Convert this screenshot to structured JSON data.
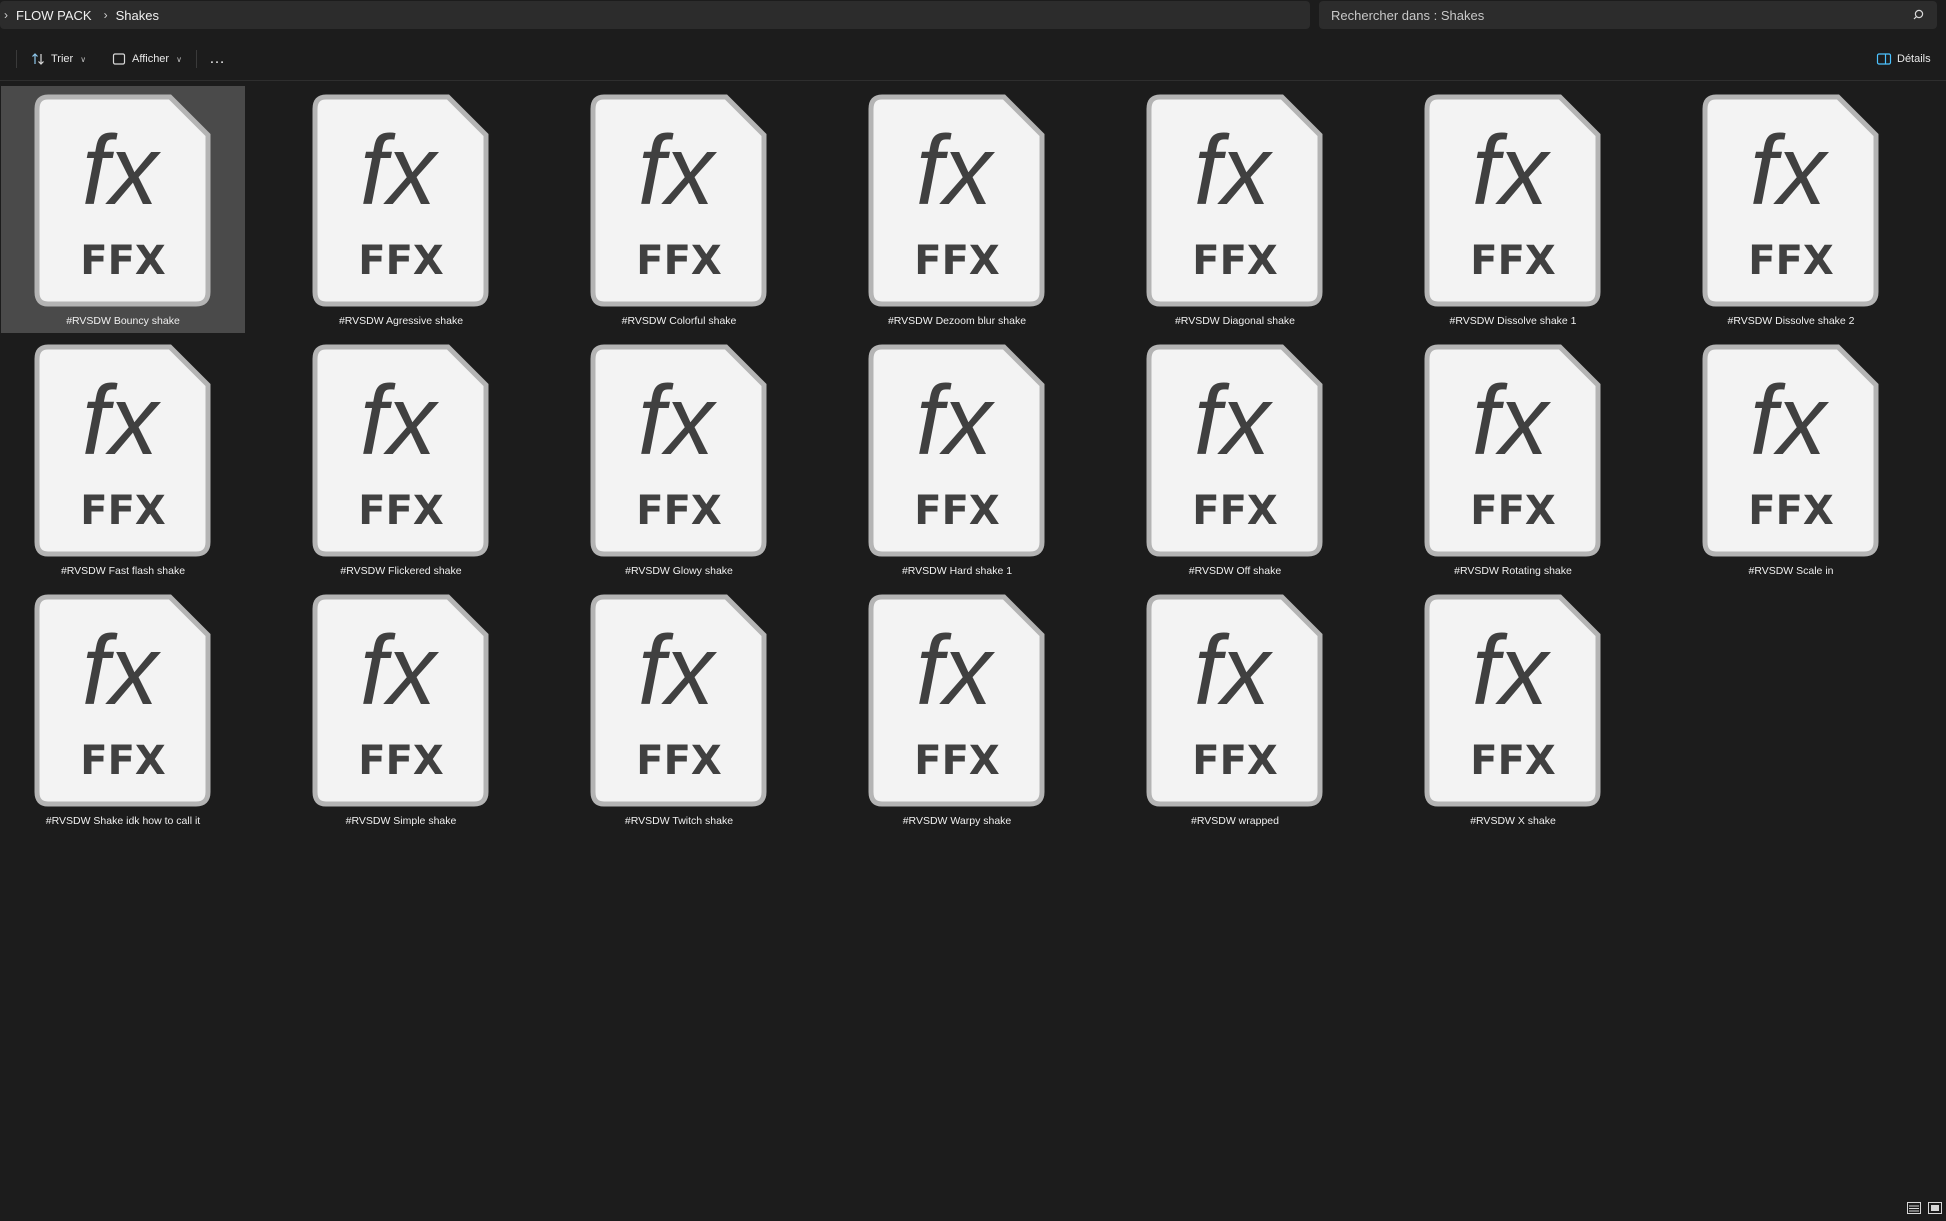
{
  "breadcrumb": {
    "items": [
      "FLOW PACK",
      "Shakes"
    ]
  },
  "search": {
    "placeholder": "Rechercher dans : Shakes"
  },
  "toolbar": {
    "sort_label": "Trier",
    "view_label": "Afficher",
    "more_label": "…",
    "details_label": "Détails"
  },
  "files": {
    "icon_fx": "fx",
    "icon_ext": "FFX",
    "items": [
      {
        "name": "#RVSDW  Bouncy shake",
        "selected": true
      },
      {
        "name": "#RVSDW Agressive shake"
      },
      {
        "name": "#RVSDW Colorful shake"
      },
      {
        "name": "#RVSDW Dezoom blur shake"
      },
      {
        "name": "#RVSDW Diagonal shake"
      },
      {
        "name": "#RVSDW Dissolve shake 1"
      },
      {
        "name": "#RVSDW Dissolve shake 2"
      },
      {
        "name": "#RVSDW Fast flash shake"
      },
      {
        "name": "#RVSDW Flickered shake"
      },
      {
        "name": "#RVSDW Glowy shake"
      },
      {
        "name": "#RVSDW Hard shake 1"
      },
      {
        "name": "#RVSDW Off shake"
      },
      {
        "name": "#RVSDW Rotating shake"
      },
      {
        "name": "#RVSDW Scale in"
      },
      {
        "name": "#RVSDW Shake idk how to call it"
      },
      {
        "name": "#RVSDW Simple shake"
      },
      {
        "name": "#RVSDW Twitch shake"
      },
      {
        "name": "#RVSDW Warpy shake"
      },
      {
        "name": "#RVSDW wrapped"
      },
      {
        "name": "#RVSDW X shake"
      }
    ]
  },
  "colors": {
    "background": "#1c1c1c",
    "selection": "#4a4a4a",
    "icon_page": "#f3f3f3",
    "icon_border": "#b4b4b4",
    "icon_glyph": "#404040",
    "accent": "#4cc2ff"
  }
}
